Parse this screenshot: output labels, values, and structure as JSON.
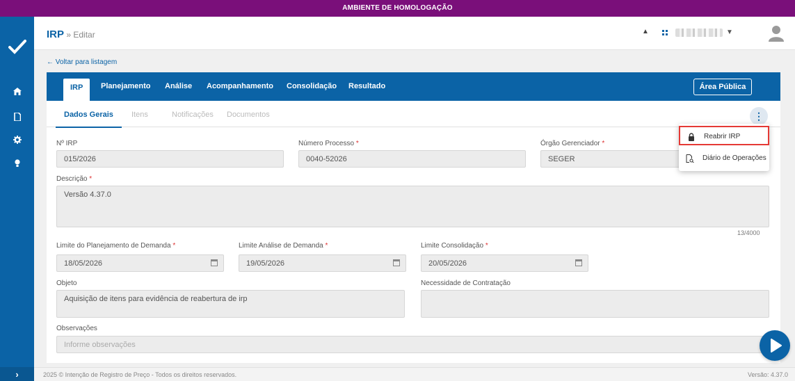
{
  "env_banner": "AMBIENTE DE HOMOLOGAÇÃO",
  "header": {
    "module": "IRP",
    "separator": " » ",
    "action": "Editar"
  },
  "back_link": "← Voltar para listagem",
  "main_tabs": [
    {
      "label": "IRP",
      "active": true
    },
    {
      "label": "Planejamento"
    },
    {
      "label": "Análise"
    },
    {
      "label": "Acompanhamento"
    },
    {
      "label": "Consolidação"
    },
    {
      "label": "Resultado"
    }
  ],
  "public_button": "Área Pública",
  "sub_tabs": [
    {
      "label": "Dados Gerais",
      "active": true
    },
    {
      "label": "Itens"
    },
    {
      "label": "Notificações"
    },
    {
      "label": "Documentos"
    }
  ],
  "kebab": "⋮",
  "form": {
    "irp_number": {
      "label": "Nº IRP",
      "value": "015/2026"
    },
    "process_number": {
      "label": "Número Processo",
      "required": "*",
      "value": "0040-52026"
    },
    "managing_body": {
      "label": "Órgão Gerenciador",
      "required": "*",
      "value": "SEGER"
    },
    "description": {
      "label": "Descrição",
      "required": "*",
      "value": "Versão 4.37.0",
      "counter": "13/4000"
    },
    "planning_limit": {
      "label": "Limite do Planejamento de Demanda",
      "required": "*",
      "value": "18/05/2026"
    },
    "analysis_limit": {
      "label": "Limite Análise de Demanda",
      "required": "*",
      "value": "19/05/2026"
    },
    "consolidation_limit": {
      "label": "Limite Consolidação",
      "required": "*",
      "value": "20/05/2026"
    },
    "object": {
      "label": "Objeto",
      "value": "Aquisição de itens para evidência de reabertura de irp"
    },
    "need": {
      "label": "Necessidade de Contratação",
      "value": ""
    },
    "observations": {
      "label": "Observações",
      "placeholder": "Informe observações"
    }
  },
  "dropdown": [
    {
      "label": "Reabrir IRP",
      "icon": "lock-icon",
      "highlighted": true
    },
    {
      "label": "Diário de Operações",
      "icon": "document-search-icon"
    }
  ],
  "footer": {
    "copyright": "2025 © Intenção de Registro de Preço - Todos os direitos reservados.",
    "version": "Versão: 4.37.0"
  },
  "sidebar_items": [
    "home-icon",
    "document-icon",
    "gear-icon",
    "lightbulb-icon"
  ],
  "colors": {
    "primary": "#0b63a6",
    "env_bar": "#7a0f7a",
    "highlight": "#e53935"
  }
}
